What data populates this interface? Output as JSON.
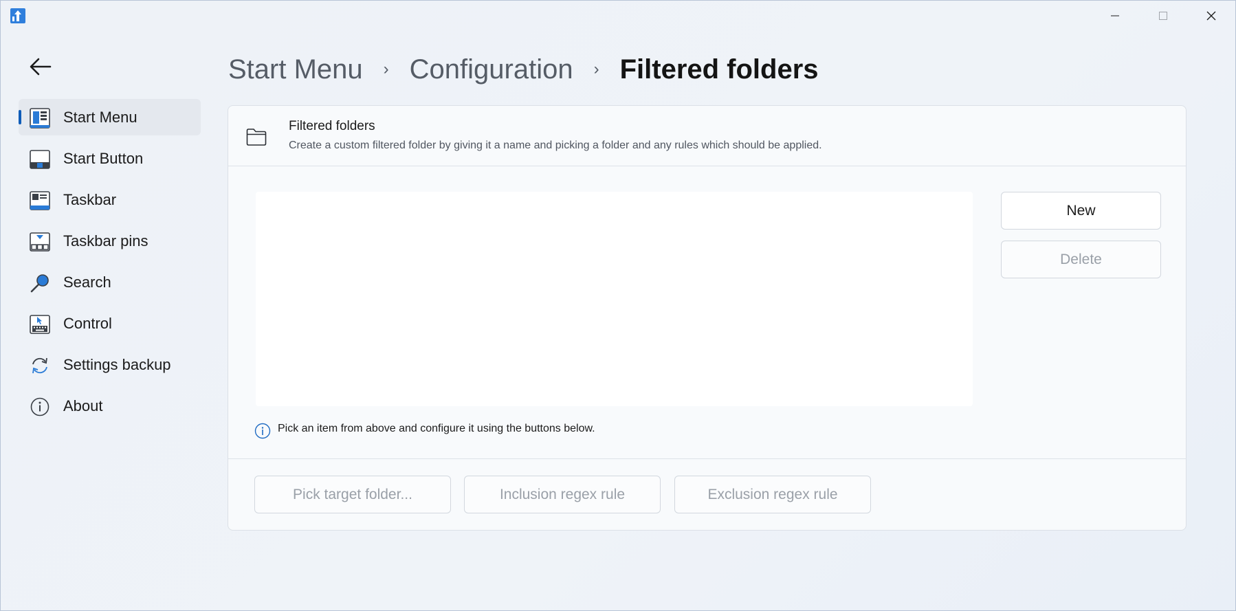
{
  "window": {
    "minimize_icon": "minimize-icon",
    "maximize_icon": "maximize-icon",
    "close_icon": "close-icon"
  },
  "sidebar": {
    "items": [
      {
        "label": "Start Menu",
        "icon": "start-menu-icon",
        "active": true
      },
      {
        "label": "Start Button",
        "icon": "start-button-icon"
      },
      {
        "label": "Taskbar",
        "icon": "taskbar-icon"
      },
      {
        "label": "Taskbar pins",
        "icon": "taskbar-pins-icon"
      },
      {
        "label": "Search",
        "icon": "search-icon"
      },
      {
        "label": "Control",
        "icon": "control-icon"
      },
      {
        "label": "Settings backup",
        "icon": "settings-backup-icon"
      },
      {
        "label": "About",
        "icon": "info-icon"
      }
    ]
  },
  "breadcrumb": {
    "items": [
      "Start Menu",
      "Configuration",
      "Filtered folders"
    ],
    "separator": "›"
  },
  "card": {
    "title": "Filtered folders",
    "description": "Create a custom filtered folder by giving it a name and picking a folder and any rules which should be applied.",
    "info_text": "Pick an item from above and configure it using the buttons below.",
    "buttons": {
      "new": "New",
      "delete": "Delete",
      "pick_target": "Pick target folder...",
      "inclusion": "Inclusion regex rule",
      "exclusion": "Exclusion regex rule"
    }
  },
  "colors": {
    "accent": "#0f5cb8",
    "disabled_text": "#9aa0a8"
  }
}
